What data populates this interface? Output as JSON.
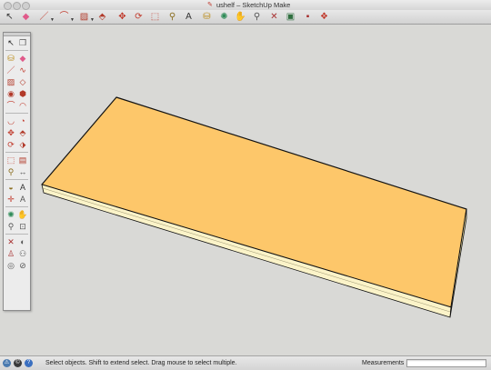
{
  "window": {
    "title": "ushelf – SketchUp Make"
  },
  "toolbar": {
    "buttons": [
      {
        "name": "select-icon",
        "glyph": "↖",
        "color": "#333333"
      },
      {
        "name": "eraser-icon",
        "glyph": "◆",
        "color": "#e05a8a"
      },
      {
        "name": "line-icon",
        "glyph": "／",
        "color": "#c0392b",
        "dropdown": true
      },
      {
        "name": "arc-icon",
        "glyph": "⌒",
        "color": "#c0392b",
        "dropdown": true
      },
      {
        "name": "rectangle-icon",
        "glyph": "▨",
        "color": "#b23a2a",
        "dropdown": true
      },
      {
        "name": "push-pull-icon",
        "glyph": "⬘",
        "color": "#b23a2a"
      },
      {
        "name": "move-icon",
        "glyph": "✥",
        "color": "#c0392b"
      },
      {
        "name": "rotate-icon",
        "glyph": "⟳",
        "color": "#c0392b"
      },
      {
        "name": "scale-icon",
        "glyph": "⬚",
        "color": "#c0392b"
      },
      {
        "name": "tape-measure-icon",
        "glyph": "⚲",
        "color": "#8a6d1e"
      },
      {
        "name": "text-icon",
        "glyph": "A",
        "color": "#333333"
      },
      {
        "name": "paint-bucket-icon",
        "glyph": "⛁",
        "color": "#b8860b"
      },
      {
        "name": "orbit-icon",
        "glyph": "✺",
        "color": "#2e8b57"
      },
      {
        "name": "pan-icon",
        "glyph": "✋",
        "color": "#c08040"
      },
      {
        "name": "zoom-icon",
        "glyph": "⚲",
        "color": "#555555"
      },
      {
        "name": "zoom-extents-icon",
        "glyph": "✕",
        "color": "#a83232"
      },
      {
        "name": "warehouse-icon",
        "glyph": "▣",
        "color": "#2f6f3f"
      },
      {
        "name": "extension-warehouse-icon",
        "glyph": "▪",
        "color": "#a52a2a"
      },
      {
        "name": "send-to-layout-icon",
        "glyph": "❖",
        "color": "#c0392b"
      }
    ]
  },
  "palette": {
    "buttons": [
      {
        "name": "select-icon",
        "glyph": "↖",
        "color": "#222222"
      },
      {
        "name": "make-component-icon",
        "glyph": "❒",
        "color": "#555555"
      },
      {
        "name": "paint-bucket-icon",
        "glyph": "⛁",
        "color": "#b8860b"
      },
      {
        "name": "eraser-icon",
        "glyph": "◆",
        "color": "#e05a8a"
      },
      {
        "name": "line-icon",
        "glyph": "／",
        "color": "#c0392b"
      },
      {
        "name": "freehand-icon",
        "glyph": "∿",
        "color": "#c0392b"
      },
      {
        "name": "rectangle-icon",
        "glyph": "▨",
        "color": "#b23a2a"
      },
      {
        "name": "rotated-rectangle-icon",
        "glyph": "◇",
        "color": "#b23a2a"
      },
      {
        "name": "circle-icon",
        "glyph": "◉",
        "color": "#b23a2a"
      },
      {
        "name": "polygon-icon",
        "glyph": "⬢",
        "color": "#b23a2a"
      },
      {
        "name": "arc-icon",
        "glyph": "⌒",
        "color": "#c0392b"
      },
      {
        "name": "two-point-arc-icon",
        "glyph": "◠",
        "color": "#c0392b"
      },
      {
        "name": "three-point-arc-icon",
        "glyph": "◡",
        "color": "#c0392b"
      },
      {
        "name": "pie-icon",
        "glyph": "◔",
        "color": "#c0392b"
      },
      {
        "name": "move-icon",
        "glyph": "✥",
        "color": "#c0392b"
      },
      {
        "name": "push-pull-icon",
        "glyph": "⬘",
        "color": "#b23a2a"
      },
      {
        "name": "rotate-icon",
        "glyph": "⟳",
        "color": "#c0392b"
      },
      {
        "name": "follow-me-icon",
        "glyph": "⬗",
        "color": "#b23a2a"
      },
      {
        "name": "scale-icon",
        "glyph": "⬚",
        "color": "#c0392b"
      },
      {
        "name": "offset-icon",
        "glyph": "▤",
        "color": "#b23a2a"
      },
      {
        "name": "tape-measure-icon",
        "glyph": "⚲",
        "color": "#8a6d1e"
      },
      {
        "name": "dimension-icon",
        "glyph": "↔",
        "color": "#555555"
      },
      {
        "name": "protractor-icon",
        "glyph": "◒",
        "color": "#8a6d1e"
      },
      {
        "name": "text-icon",
        "glyph": "A",
        "color": "#333333"
      },
      {
        "name": "axes-icon",
        "glyph": "✛",
        "color": "#c0392b"
      },
      {
        "name": "3d-text-icon",
        "glyph": "A",
        "color": "#555555"
      },
      {
        "name": "orbit-icon",
        "glyph": "✺",
        "color": "#2e8b57"
      },
      {
        "name": "pan-icon",
        "glyph": "✋",
        "color": "#c08040"
      },
      {
        "name": "zoom-icon",
        "glyph": "⚲",
        "color": "#555555"
      },
      {
        "name": "zoom-window-icon",
        "glyph": "⊡",
        "color": "#555555"
      },
      {
        "name": "zoom-extents-icon",
        "glyph": "✕",
        "color": "#a83232"
      },
      {
        "name": "previous-view-icon",
        "glyph": "◐",
        "color": "#555555"
      },
      {
        "name": "position-camera-icon",
        "glyph": "♙",
        "color": "#a83232"
      },
      {
        "name": "walk-icon",
        "glyph": "⚇",
        "color": "#555555"
      },
      {
        "name": "look-around-icon",
        "glyph": "◎",
        "color": "#555555"
      },
      {
        "name": "section-plane-icon",
        "glyph": "⊘",
        "color": "#555555"
      }
    ]
  },
  "model": {
    "top_color": "#fdc76a",
    "front_color": "#fbf3c8",
    "side_color": "#f3e6a8",
    "edge_color": "#111111"
  },
  "statusbar": {
    "message": "Select objects. Shift to extend select. Drag mouse to select multiple.",
    "measurements_label": "Measurements",
    "measurements_value": "",
    "icons": [
      {
        "name": "geo-location-icon",
        "glyph": "⚠",
        "color": "#4a7ab0"
      },
      {
        "name": "credits-icon",
        "glyph": "©",
        "color": "#3a3a3a"
      },
      {
        "name": "help-icon",
        "glyph": "?",
        "color": "#3a6fc0"
      }
    ]
  }
}
